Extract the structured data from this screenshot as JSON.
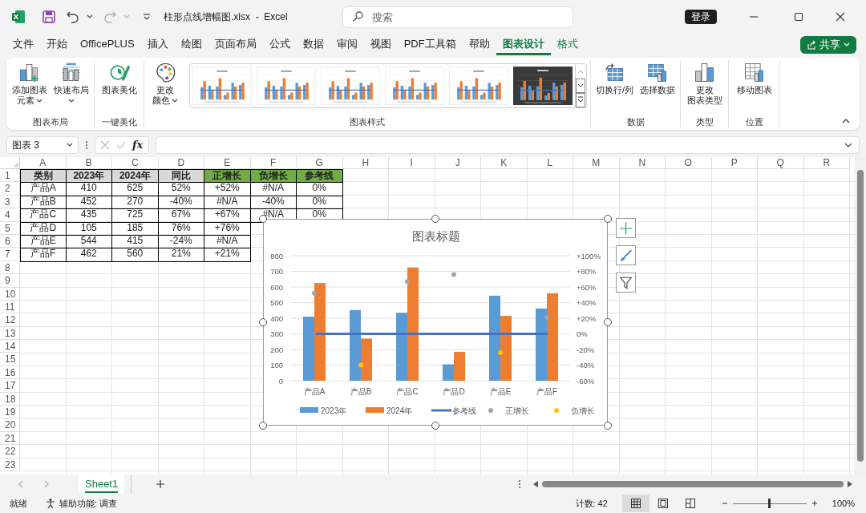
{
  "title_bar": {
    "title": "柱形点线增幅图.xlsx  -  Excel",
    "search_placeholder": "搜索",
    "sign_in": "登录"
  },
  "menu_tabs": [
    {
      "label": "文件",
      "selected": false,
      "kind": "normal"
    },
    {
      "label": "开始",
      "selected": false,
      "kind": "normal"
    },
    {
      "label": "OfficePLUS",
      "selected": false,
      "kind": "normal"
    },
    {
      "label": "插入",
      "selected": false,
      "kind": "normal"
    },
    {
      "label": "绘图",
      "selected": false,
      "kind": "normal"
    },
    {
      "label": "页面布局",
      "selected": false,
      "kind": "normal"
    },
    {
      "label": "公式",
      "selected": false,
      "kind": "normal"
    },
    {
      "label": "数据",
      "selected": false,
      "kind": "normal"
    },
    {
      "label": "审阅",
      "selected": false,
      "kind": "normal"
    },
    {
      "label": "视图",
      "selected": false,
      "kind": "normal"
    },
    {
      "label": "PDF工具箱",
      "selected": false,
      "kind": "normal"
    },
    {
      "label": "帮助",
      "selected": false,
      "kind": "normal"
    },
    {
      "label": "图表设计",
      "selected": true,
      "kind": "contextual"
    },
    {
      "label": "格式",
      "selected": false,
      "kind": "contextual"
    }
  ],
  "share_button": {
    "label": "共享"
  },
  "ribbon_groups": [
    {
      "label": "图表布局",
      "buttons": [
        {
          "lines": [
            "添加图表",
            "元素"
          ],
          "dropdown": true
        },
        {
          "lines": [
            "快速布局"
          ],
          "dropdown": true
        }
      ]
    },
    {
      "label": "一键美化",
      "buttons": [
        {
          "lines": [
            "图表美化"
          ],
          "dropdown": false
        }
      ]
    },
    {
      "label": "图表样式",
      "buttons": [
        {
          "lines": [
            "更改",
            "颜色"
          ],
          "dropdown": true
        }
      ],
      "gallery": [
        {
          "kind": "light"
        },
        {
          "kind": "light"
        },
        {
          "kind": "light"
        },
        {
          "kind": "light"
        },
        {
          "kind": "light"
        },
        {
          "kind": "dark"
        }
      ]
    },
    {
      "label": "数据",
      "buttons": [
        {
          "lines": [
            "切换行/列"
          ],
          "dropdown": false
        },
        {
          "lines": [
            "选择数据"
          ],
          "dropdown": false
        }
      ]
    },
    {
      "label": "类型",
      "buttons": [
        {
          "lines": [
            "更改",
            "图表类型"
          ],
          "dropdown": false
        }
      ]
    },
    {
      "label": "位置",
      "buttons": [
        {
          "lines": [
            "移动图表"
          ],
          "dropdown": false
        }
      ]
    }
  ],
  "formula_bar": {
    "name_box": "图表 3",
    "fx": "fx"
  },
  "sheet": {
    "columns": [
      "A",
      "B",
      "C",
      "D",
      "E",
      "F",
      "G",
      "H",
      "I",
      "J",
      "K",
      "L",
      "M",
      "N",
      "O",
      "P",
      "Q",
      "R"
    ],
    "row_numbers": [
      "1",
      "2",
      "3",
      "4",
      "5",
      "6",
      "7",
      "8",
      "9",
      "10",
      "11",
      "12",
      "13",
      "14",
      "15",
      "16",
      "17",
      "18",
      "19",
      "20",
      "21",
      "22",
      "23"
    ],
    "rows": [
      [
        {
          "text": "类别",
          "color": "#d9d9d9"
        },
        {
          "text": "2023年",
          "color": "#d9d9d9"
        },
        {
          "text": "2024年",
          "color": "#d9d9d9"
        },
        {
          "text": "同比",
          "color": "#d9d9d9"
        },
        {
          "text": "正增长",
          "color": "#70ad47"
        },
        {
          "text": "负增长",
          "color": "#70ad47"
        },
        {
          "text": "参考线",
          "color": "#70ad47"
        }
      ],
      [
        {
          "text": "产品A"
        },
        {
          "text": "410"
        },
        {
          "text": "625"
        },
        {
          "text": "52%"
        },
        {
          "text": "+52%"
        },
        {
          "text": "#N/A"
        },
        {
          "text": "0%"
        }
      ],
      [
        {
          "text": "产品B"
        },
        {
          "text": "452"
        },
        {
          "text": "270"
        },
        {
          "text": "-40%"
        },
        {
          "text": "#N/A"
        },
        {
          "text": "-40%"
        },
        {
          "text": "0%"
        }
      ],
      [
        {
          "text": "产品C"
        },
        {
          "text": "435"
        },
        {
          "text": "725"
        },
        {
          "text": "67%"
        },
        {
          "text": "+67%"
        },
        {
          "text": "#N/A"
        },
        {
          "text": "0%"
        }
      ],
      [
        {
          "text": "产品D"
        },
        {
          "text": "105"
        },
        {
          "text": "185"
        },
        {
          "text": "76%"
        },
        {
          "text": "+76%"
        }
      ],
      [
        {
          "text": "产品E"
        },
        {
          "text": "544"
        },
        {
          "text": "415"
        },
        {
          "text": "-24%"
        },
        {
          "text": "#N/A"
        }
      ],
      [
        {
          "text": "产品F"
        },
        {
          "text": "462"
        },
        {
          "text": "560"
        },
        {
          "text": "21%"
        },
        {
          "text": "+21%"
        }
      ]
    ]
  },
  "chart": {
    "chart_data": {
      "type": "bar",
      "title": "图表标题",
      "categories": [
        "产品A",
        "产品B",
        "产品C",
        "产品D",
        "产品E",
        "产品F"
      ],
      "series": [
        {
          "name": "2023年",
          "color": "#5b9bd5",
          "values": [
            410,
            452,
            435,
            105,
            544,
            462
          ]
        },
        {
          "name": "2024年",
          "color": "#ed7d31",
          "values": [
            625,
            270,
            725,
            185,
            415,
            560
          ]
        },
        {
          "name": "参考线",
          "type": "line",
          "axis": "y2",
          "color": "#4472c4",
          "values": [
            0,
            0,
            0,
            0,
            0,
            0
          ]
        },
        {
          "name": "正增长",
          "type": "scatter",
          "axis": "y2",
          "color": "#a5a5a5",
          "values": [
            52,
            null,
            67,
            76,
            null,
            21
          ]
        },
        {
          "name": "负增长",
          "type": "scatter",
          "axis": "y2",
          "color": "#ffc000",
          "values": [
            null,
            -40,
            null,
            null,
            -24,
            null
          ]
        }
      ],
      "stacked": false,
      "grid": true,
      "legend": true,
      "ylim": [
        0,
        800
      ],
      "yticks": [
        0,
        100,
        200,
        300,
        400,
        500,
        600,
        700,
        800
      ],
      "y2lim": [
        -60,
        100
      ],
      "y2ticks": [
        {
          "value": 100,
          "label": "+100%"
        },
        {
          "value": 80,
          "label": "+80%"
        },
        {
          "value": 60,
          "label": "+60%"
        },
        {
          "value": 40,
          "label": "+40%"
        },
        {
          "value": 20,
          "label": "+20%"
        },
        {
          "value": 0,
          "label": "0%"
        },
        {
          "value": -20,
          "label": "-20%"
        },
        {
          "value": -40,
          "label": "-40%"
        },
        {
          "value": -60,
          "label": "-60%"
        }
      ]
    }
  },
  "sheet_tabs": [
    {
      "label": "Sheet1",
      "selected": true
    }
  ],
  "status_bar": {
    "mode": "就绪",
    "accessibility": "辅助功能: 调查",
    "count": "计数: 42",
    "views": [
      {
        "selected": true
      },
      {
        "selected": false
      },
      {
        "selected": false
      }
    ],
    "zoom": {
      "level": 0.5,
      "label": "100%"
    }
  }
}
